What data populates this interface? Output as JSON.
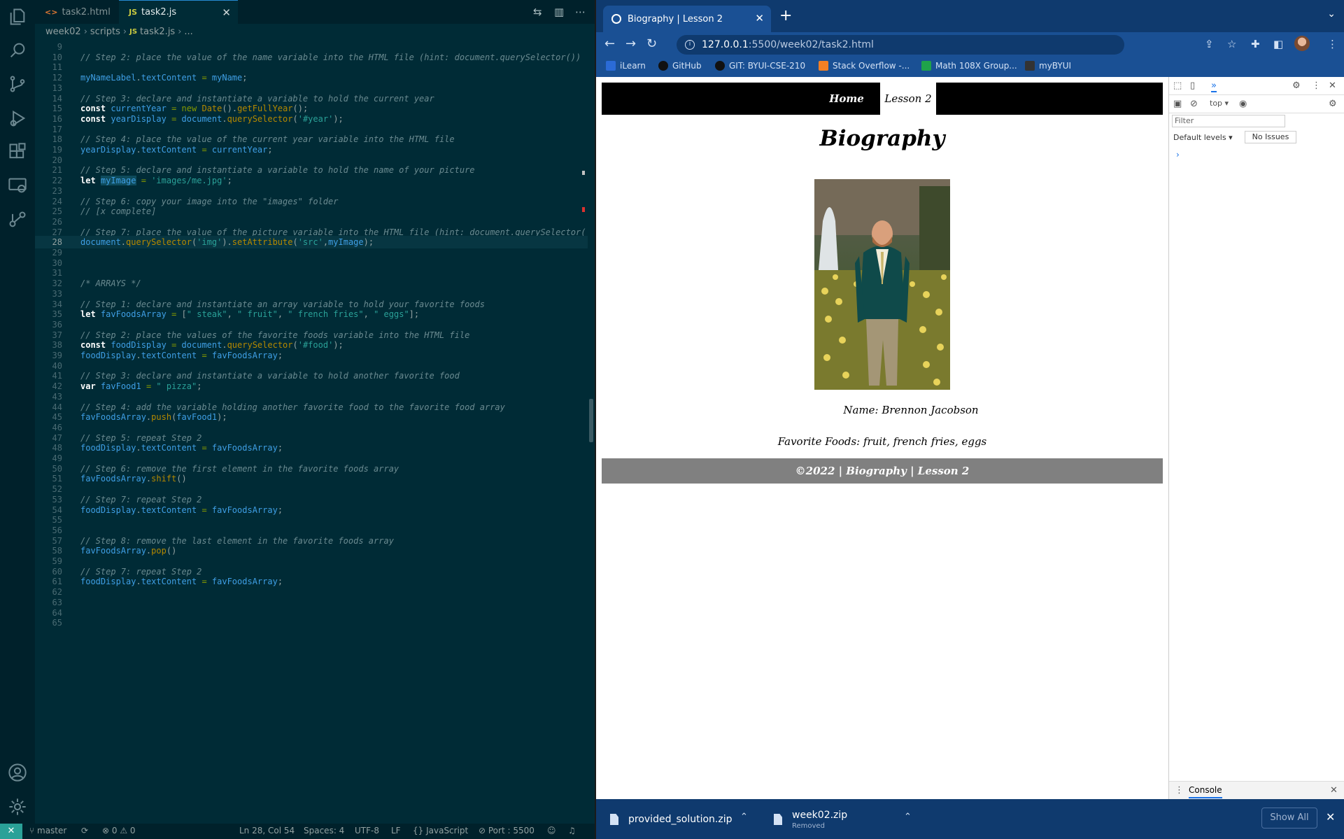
{
  "editor": {
    "tabs": [
      {
        "label": "task2.html",
        "icon": "<>"
      },
      {
        "label": "task2.js",
        "icon": "JS"
      }
    ],
    "breadcrumb": [
      "week02",
      "scripts",
      "task2.js",
      "..."
    ],
    "lines": [
      {
        "n": "9",
        "code": ""
      },
      {
        "n": "10",
        "code": "// Step 2: place the value of the name variable into the HTML file (hint: document.querySelector())"
      },
      {
        "n": "11",
        "code": ""
      },
      {
        "n": "12",
        "code": "myNameLabel.textContent = myName;"
      },
      {
        "n": "13",
        "code": ""
      },
      {
        "n": "14",
        "code": "// Step 3: declare and instantiate a variable to hold the current year"
      },
      {
        "n": "15",
        "code": "const currentYear = new Date().getFullYear();"
      },
      {
        "n": "16",
        "code": "const yearDisplay = document.querySelector('#year');"
      },
      {
        "n": "17",
        "code": ""
      },
      {
        "n": "18",
        "code": "// Step 4: place the value of the current year variable into the HTML file"
      },
      {
        "n": "19",
        "code": "yearDisplay.textContent = currentYear;"
      },
      {
        "n": "20",
        "code": ""
      },
      {
        "n": "21",
        "code": "// Step 5: declare and instantiate a variable to hold the name of your picture"
      },
      {
        "n": "22",
        "code": "let myImage = 'images/me.jpg';"
      },
      {
        "n": "23",
        "code": ""
      },
      {
        "n": "24",
        "code": "// Step 6: copy your image into the \"images\" folder"
      },
      {
        "n": "25",
        "code": "// [x complete]"
      },
      {
        "n": "26",
        "code": ""
      },
      {
        "n": "27",
        "code": "// Step 7: place the value of the picture variable into the HTML file (hint: document.querySelector("
      },
      {
        "n": "28",
        "code": "document.querySelector('img').setAttribute('src',myImage);"
      },
      {
        "n": "29",
        "code": ""
      },
      {
        "n": "30",
        "code": ""
      },
      {
        "n": "31",
        "code": ""
      },
      {
        "n": "32",
        "code": "/* ARRAYS */"
      },
      {
        "n": "33",
        "code": ""
      },
      {
        "n": "34",
        "code": "// Step 1: declare and instantiate an array variable to hold your favorite foods"
      },
      {
        "n": "35",
        "code": "let favFoodsArray = [\" steak\", \" fruit\", \" french fries\", \" eggs\"];"
      },
      {
        "n": "36",
        "code": ""
      },
      {
        "n": "37",
        "code": "// Step 2: place the values of the favorite foods variable into the HTML file"
      },
      {
        "n": "38",
        "code": "const foodDisplay = document.querySelector('#food');"
      },
      {
        "n": "39",
        "code": "foodDisplay.textContent = favFoodsArray;"
      },
      {
        "n": "40",
        "code": ""
      },
      {
        "n": "41",
        "code": "// Step 3: declare and instantiate a variable to hold another favorite food"
      },
      {
        "n": "42",
        "code": "var favFood1 = \" pizza\";"
      },
      {
        "n": "43",
        "code": ""
      },
      {
        "n": "44",
        "code": "// Step 4: add the variable holding another favorite food to the favorite food array"
      },
      {
        "n": "45",
        "code": "favFoodsArray.push(favFood1);"
      },
      {
        "n": "46",
        "code": ""
      },
      {
        "n": "47",
        "code": "// Step 5: repeat Step 2"
      },
      {
        "n": "48",
        "code": "foodDisplay.textContent = favFoodsArray;"
      },
      {
        "n": "49",
        "code": ""
      },
      {
        "n": "50",
        "code": "// Step 6: remove the first element in the favorite foods array"
      },
      {
        "n": "51",
        "code": "favFoodsArray.shift()"
      },
      {
        "n": "52",
        "code": ""
      },
      {
        "n": "53",
        "code": "// Step 7: repeat Step 2"
      },
      {
        "n": "54",
        "code": "foodDisplay.textContent = favFoodsArray;"
      },
      {
        "n": "55",
        "code": ""
      },
      {
        "n": "56",
        "code": ""
      },
      {
        "n": "57",
        "code": "// Step 8: remove the last element in the favorite foods array"
      },
      {
        "n": "58",
        "code": "favFoodsArray.pop()"
      },
      {
        "n": "59",
        "code": ""
      },
      {
        "n": "60",
        "code": "// Step 7: repeat Step 2"
      },
      {
        "n": "61",
        "code": "foodDisplay.textContent = favFoodsArray;"
      },
      {
        "n": "62",
        "code": ""
      },
      {
        "n": "63",
        "code": ""
      },
      {
        "n": "64",
        "code": ""
      },
      {
        "n": "65",
        "code": ""
      }
    ],
    "current_line": "28",
    "statusbar": {
      "branch": "master",
      "problems": "0",
      "warnings": "0",
      "position": "Ln 28, Col 54",
      "spaces": "Spaces: 4",
      "encoding": "UTF-8",
      "eol": "LF",
      "language": "JavaScript",
      "port": "Port : 5500"
    }
  },
  "browser": {
    "tab_title": "Biography | Lesson 2",
    "url_host": "127.0.0.1",
    "url_path": ":5500/week02/task2.html",
    "bookmarks": [
      "iLearn",
      "GitHub",
      "GIT: BYUI-CSE-210",
      "Stack Overflow -...",
      "Math 108X Group...",
      "myBYUI"
    ],
    "page": {
      "nav_home": "Home",
      "nav_lesson": "Lesson 2",
      "heading": "Biography",
      "name_line": "Name: Brennon Jacobson",
      "foods_line": "Favorite Foods: fruit, french fries, eggs",
      "footer": "©2022 | Biography | Lesson 2"
    },
    "devtools": {
      "context": "top",
      "filter_placeholder": "Filter",
      "levels": "Default levels",
      "issues": "No Issues",
      "drawer_tab": "Console"
    },
    "downloads": [
      {
        "name": "provided_solution.zip",
        "status": ""
      },
      {
        "name": "week02.zip",
        "status": "Removed"
      }
    ],
    "show_all": "Show All"
  },
  "colors": {
    "editor_bg": "#002b36",
    "activity_bg": "#00212b",
    "chrome_frame": "#1a5094",
    "footer_gray": "#808080"
  }
}
